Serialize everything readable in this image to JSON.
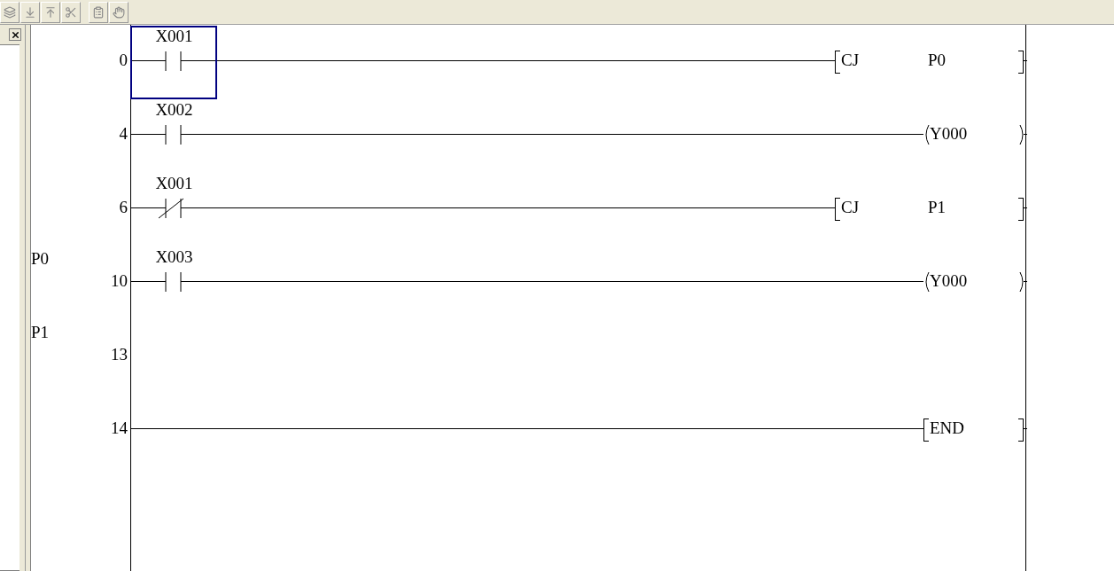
{
  "rungs": [
    {
      "step": "0",
      "contacts": [
        {
          "kind": "no",
          "device": "X001",
          "selected": true
        }
      ],
      "output": {
        "kind": "instruction",
        "op": "CJ",
        "operand": "P0"
      }
    },
    {
      "step": "4",
      "contacts": [
        {
          "kind": "no",
          "device": "X002",
          "selected": false
        }
      ],
      "output": {
        "kind": "coil",
        "op": "Y000"
      }
    },
    {
      "step": "6",
      "contacts": [
        {
          "kind": "nc",
          "device": "X001",
          "selected": false
        }
      ],
      "output": {
        "kind": "instruction",
        "op": "CJ",
        "operand": "P1"
      }
    },
    {
      "pointer": "P0",
      "step": "10",
      "contacts": [
        {
          "kind": "no",
          "device": "X003",
          "selected": false
        }
      ],
      "output": {
        "kind": "coil",
        "op": "Y000"
      }
    },
    {
      "pointer": "P1",
      "step": "13"
    },
    {
      "step": "14",
      "output": {
        "kind": "instruction",
        "op": "END"
      }
    }
  ]
}
